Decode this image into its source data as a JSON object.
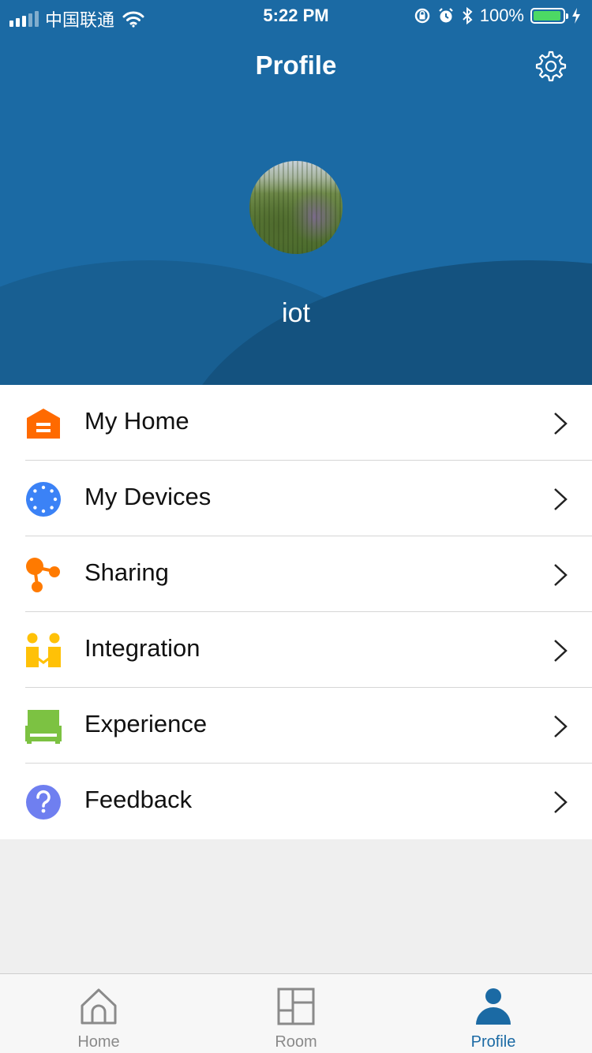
{
  "status_bar": {
    "carrier": "中国联通",
    "time": "5:22 PM",
    "battery": "100%"
  },
  "header": {
    "title": "Profile",
    "settings_icon": "gear-icon",
    "username": "iot"
  },
  "menu": [
    {
      "label": "My Home",
      "icon": "home-icon",
      "color": "#ff6a00"
    },
    {
      "label": "My Devices",
      "icon": "devices-icon",
      "color": "#3b82f6"
    },
    {
      "label": "Sharing",
      "icon": "sharing-icon",
      "color": "#ff7a00"
    },
    {
      "label": "Integration",
      "icon": "integration-icon",
      "color": "#ffc107"
    },
    {
      "label": "Experience",
      "icon": "experience-icon",
      "color": "#7cc242"
    },
    {
      "label": "Feedback",
      "icon": "feedback-icon",
      "color": "#6f7ff0"
    }
  ],
  "tabbar": {
    "tabs": [
      {
        "label": "Home",
        "icon": "home-outline-icon"
      },
      {
        "label": "Room",
        "icon": "room-grid-icon"
      },
      {
        "label": "Profile",
        "icon": "person-icon",
        "active": true
      }
    ]
  },
  "colors": {
    "header_bg": "#1b6aa4",
    "accent": "#1b6aa4"
  }
}
